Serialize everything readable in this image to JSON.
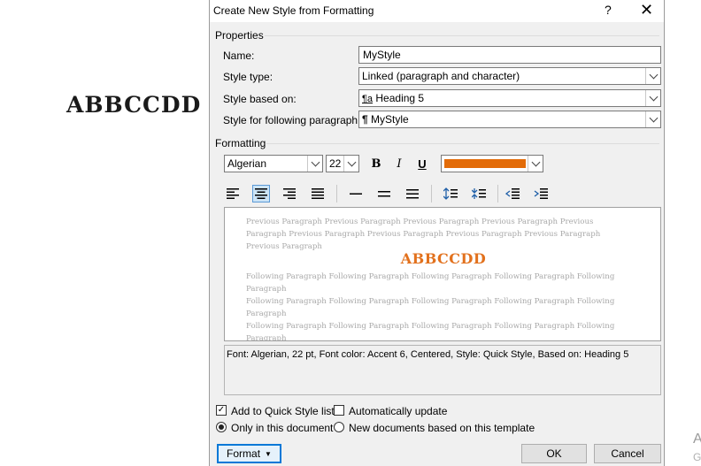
{
  "background": {
    "doc_text": "ABBCCDD",
    "corner_text_1": "A",
    "corner_text_2": "G"
  },
  "dialog": {
    "title": "Create New Style from Formatting",
    "help_label": "?",
    "close_label": "✕",
    "properties": {
      "group_label": "Properties",
      "name_label": "Name:",
      "name_value": "MyStyle",
      "style_type_label": "Style type:",
      "style_type_value": "Linked (paragraph and character)",
      "based_on_label": "Style based on:",
      "based_on_value": "Heading 5",
      "following_label": "Style for following paragraph:",
      "following_value": "MyStyle"
    },
    "formatting": {
      "group_label": "Formatting",
      "font_value": "Algerian",
      "size_value": "22",
      "bold_label": "B",
      "italic_label": "I",
      "underline_label": "U",
      "font_color": "#e36c09"
    },
    "preview": {
      "previous_text": "Previous Paragraph Previous Paragraph Previous Paragraph Previous Paragraph Previous Paragraph Previous Paragraph Previous Paragraph Previous Paragraph Previous Paragraph Previous Paragraph",
      "sample_text": "ABBCCDD",
      "following_line": "Following Paragraph Following Paragraph Following Paragraph Following Paragraph Following Paragraph"
    },
    "description": "Font: Algerian, 22 pt, Font color: Accent 6, Centered, Style: Quick Style, Based on: Heading 5",
    "options": {
      "quick_style_label": "Add to Quick Style list",
      "quick_style_checked": true,
      "auto_update_label": "Automatically update",
      "auto_update_checked": false,
      "only_doc_label": "Only in this document",
      "new_docs_label": "New documents based on this template"
    },
    "buttons": {
      "format_label": "Format",
      "ok_label": "OK",
      "cancel_label": "Cancel"
    },
    "colors": {
      "accent": "#e36c09",
      "focus": "#0078d7",
      "selected_bg": "#cce4f7"
    }
  }
}
